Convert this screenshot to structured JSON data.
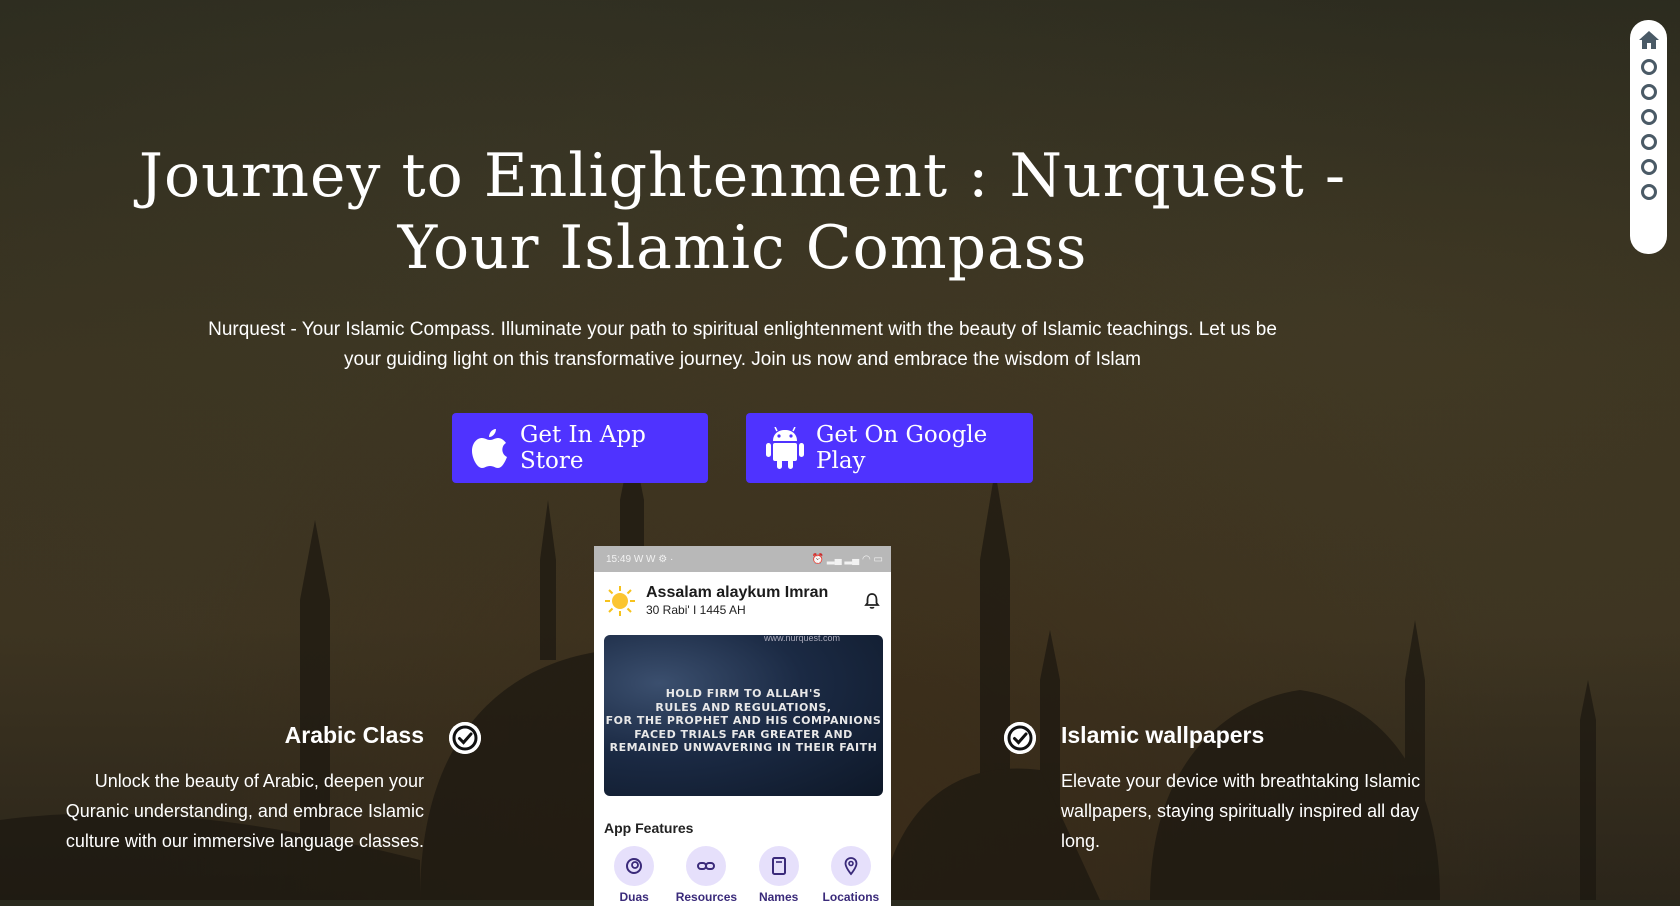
{
  "hero": {
    "title": "Journey to Enlightenment : Nurquest - Your Islamic Compass",
    "subtitle": "Nurquest - Your Islamic Compass. Illuminate your path to spiritual enlightenment with the beauty of Islamic teachings. Let us be your guiding light on this transformative journey. Join us now and embrace the wisdom of Islam"
  },
  "buttons": {
    "app_store": {
      "label": "Get In App Store",
      "icon": "apple-icon"
    },
    "google_play": {
      "label": "Get On Google Play",
      "icon": "android-icon"
    }
  },
  "features": {
    "left": {
      "title": "Arabic Class",
      "description": "Unlock the beauty of Arabic, deepen your Quranic understanding, and embrace Islamic culture with our immersive language classes."
    },
    "right": {
      "title": "Islamic wallpapers",
      "description": "Elevate your device with breathtaking Islamic wallpapers, staying spiritually inspired all day long."
    }
  },
  "phone": {
    "status_time": "15:49",
    "status_extra": "W W",
    "greeting": "Assalam alaykum Imran",
    "hijri_date": "30 Rabi' I 1445 AH",
    "banner_url": "www.nurquest.com",
    "banner_lines": [
      "HOLD FIRM TO ALLAH'S",
      "RULES AND REGULATIONS,",
      "FOR THE PROPHET AND HIS COMPANIONS",
      "FACED TRIALS FAR GREATER AND",
      "REMAINED UNWAVERING IN THEIR FAITH"
    ],
    "features_label": "App Features",
    "app_features": [
      {
        "label": "Duas",
        "icon": "duas-icon"
      },
      {
        "label": "Resources",
        "icon": "link-icon"
      },
      {
        "label": "Names",
        "icon": "book-icon"
      },
      {
        "label": "Locations",
        "icon": "location-pin-icon"
      }
    ]
  },
  "side_nav": {
    "items": [
      "home-icon",
      "section-dot",
      "section-dot",
      "section-dot",
      "section-dot",
      "section-dot",
      "section-dot"
    ]
  },
  "colors": {
    "button_bg": "#4f33ff",
    "feature_circle": "#e6e0fb"
  }
}
